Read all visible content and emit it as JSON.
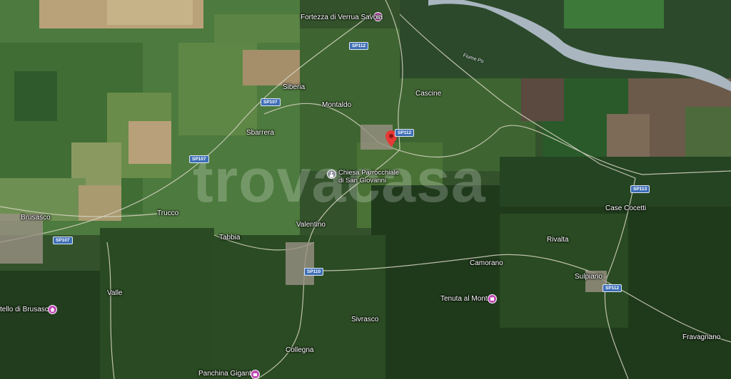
{
  "watermark": "trovacasa",
  "places": {
    "fortezza": "Fortezza di Verrua Savoia",
    "siberia": "Siberia",
    "montaldo": "Montaldo",
    "cascine": "Cascine",
    "sbarrera": "Sbarrera",
    "chiesa": "Chiesa Parrocchiale\ndi San Giovanni",
    "trucco": "Trucco",
    "brusasco": "Brusasco",
    "tabbia": "Tabbia",
    "valentino": "Valentino",
    "case_cocetti": "Case Cocetti",
    "rivalta": "Rivalta",
    "camorano": "Camorano",
    "sulpiano": "Sulpiano",
    "valle": "Valle",
    "castello": "tello di Brusasco",
    "tenuta": "Tenuta al Monte",
    "sivrasco": "Sivrasco",
    "fravagnano": "Fravagnano",
    "collegna": "Collegna",
    "panchina": "Panchina Gigante",
    "fiume": "Fiume Po"
  },
  "roads": {
    "sp112_a": "SP112",
    "sp112_b": "SP112",
    "sp112_c": "SP112",
    "sp107_a": "SP107",
    "sp107_b": "SP107",
    "sp107_c": "SP107",
    "sp110": "SP110",
    "sp113": "SP113"
  },
  "icons": {
    "selected": "location-pin-icon",
    "church": "church-icon",
    "attraction": "attraction-icon"
  },
  "colors": {
    "pin": "#e53935",
    "road_shield": "#3f6fb6",
    "attraction": "#c04ab5",
    "river": "#a9b6c0"
  }
}
